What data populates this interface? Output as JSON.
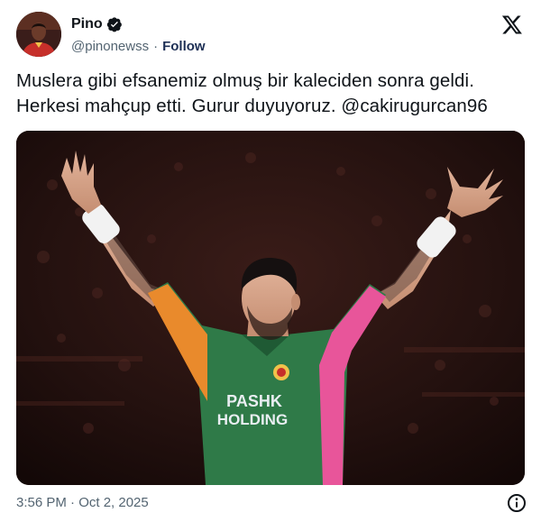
{
  "author": {
    "name": "Pino",
    "handle": "@pinonewss",
    "separator": "·",
    "follow_label": "Follow",
    "verified": true
  },
  "tweet": {
    "text_lines": [
      "Muslera gibi efsanemiz olmuş bir kaleciden sonra geldi.",
      "Herkesi mahçup etti. Gurur duyuyoruz. @cakirugurcan96"
    ],
    "timestamp": "3:56 PM · Oct 2, 2025"
  },
  "media": {
    "sponsor_line1": "PASHK",
    "sponsor_line2": "HOLDING"
  },
  "icons": {
    "brand": "x-logo-icon",
    "verified": "verified-badge-icon",
    "info": "info-icon"
  },
  "colors": {
    "follow": "#1d2f55",
    "secondary_text": "#536471",
    "kit_green": "#2f7a48",
    "kit_pink": "#e8559a",
    "kit_orange": "#e98a2c"
  }
}
